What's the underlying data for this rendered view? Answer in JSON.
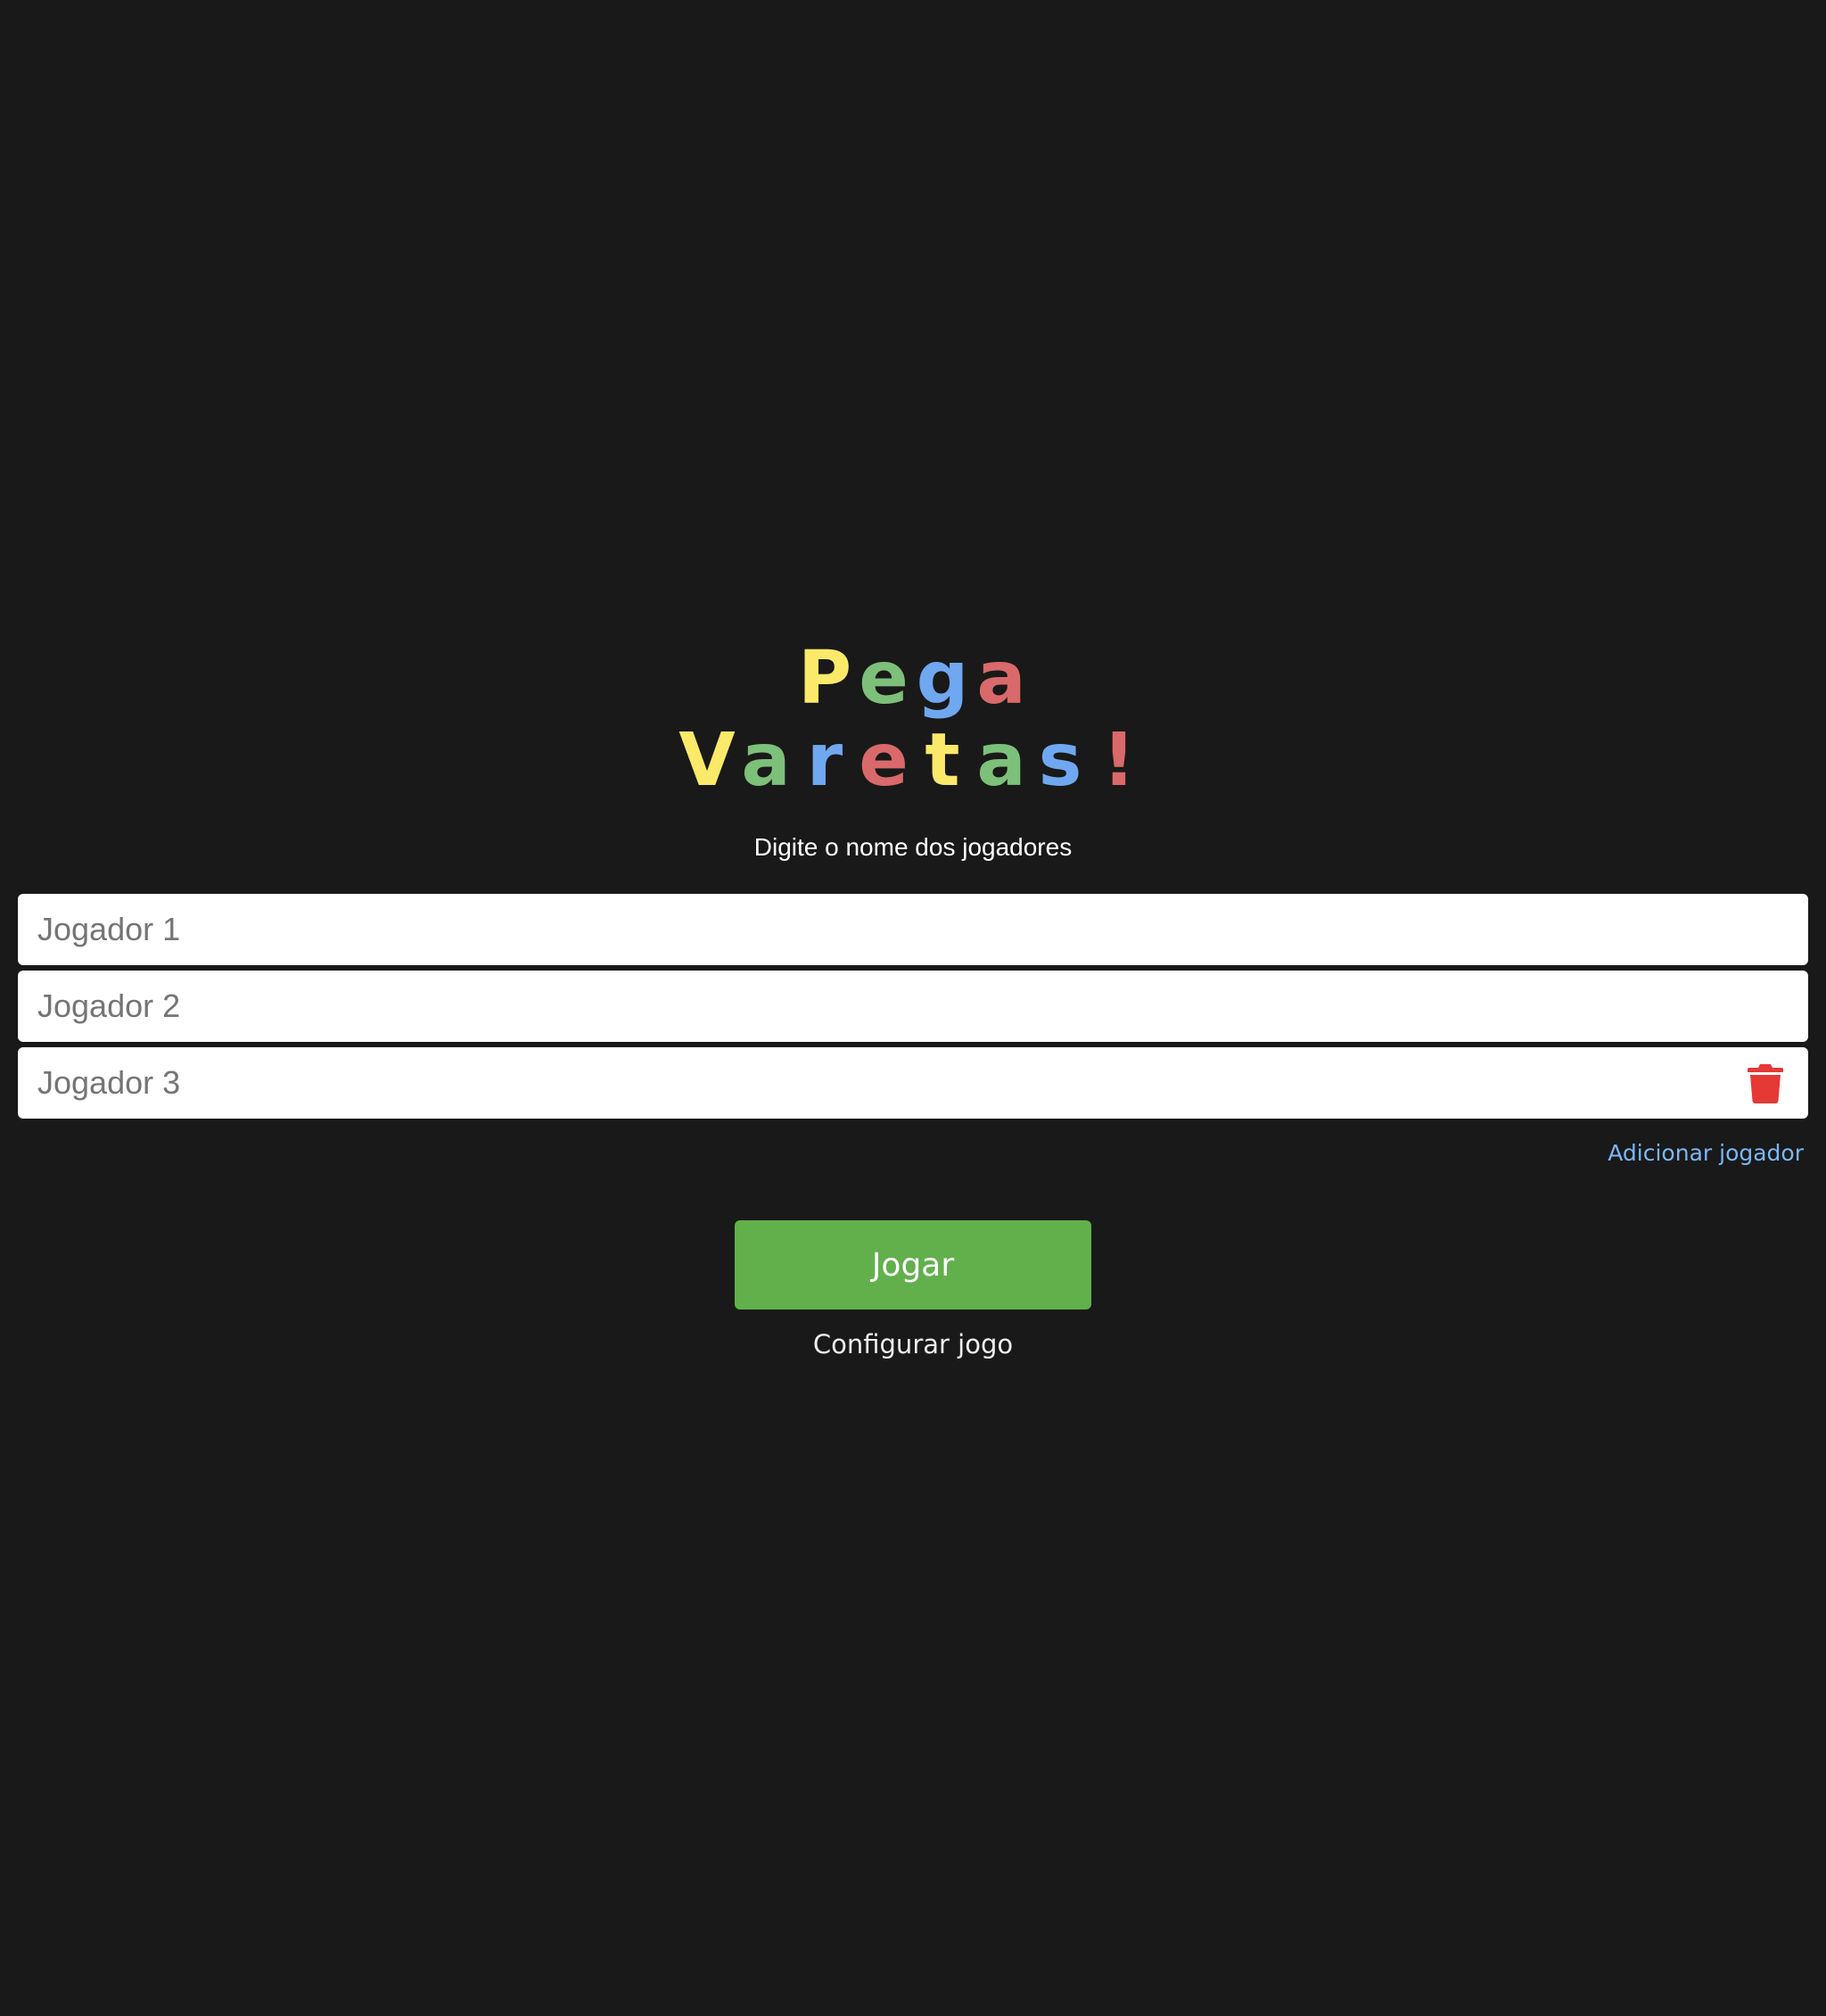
{
  "title": {
    "line1": [
      {
        "char": "P",
        "color": "#fbe96a"
      },
      {
        "char": "e",
        "color": "#7dc07a"
      },
      {
        "char": "g",
        "color": "#6fa8f0"
      },
      {
        "char": "a",
        "color": "#d9696b"
      }
    ],
    "line2": [
      {
        "char": "V",
        "color": "#fbe96a"
      },
      {
        "char": "a",
        "color": "#7dc07a"
      },
      {
        "char": "r",
        "color": "#6fa8f0"
      },
      {
        "char": "e",
        "color": "#d9696b"
      },
      {
        "char": "t",
        "color": "#fbe96a"
      },
      {
        "char": "a",
        "color": "#7dc07a"
      },
      {
        "char": "s",
        "color": "#6fa8f0"
      },
      {
        "char": "!",
        "color": "#d9696b"
      }
    ]
  },
  "subtitle": "Digite o nome dos jogadores",
  "players": [
    {
      "placeholder": "Jogador 1",
      "value": "",
      "removable": false
    },
    {
      "placeholder": "Jogador 2",
      "value": "",
      "removable": false
    },
    {
      "placeholder": "Jogador 3",
      "value": "",
      "removable": true
    }
  ],
  "delete_icon": {
    "name": "trash-icon",
    "color": "#e53935"
  },
  "add_player_label": "Adicionar jogador",
  "play_button_label": "Jogar",
  "config_label": "Configurar jogo",
  "colors": {
    "background": "#191919",
    "play_button": "#62b04c",
    "link": "#7cb7f5"
  }
}
